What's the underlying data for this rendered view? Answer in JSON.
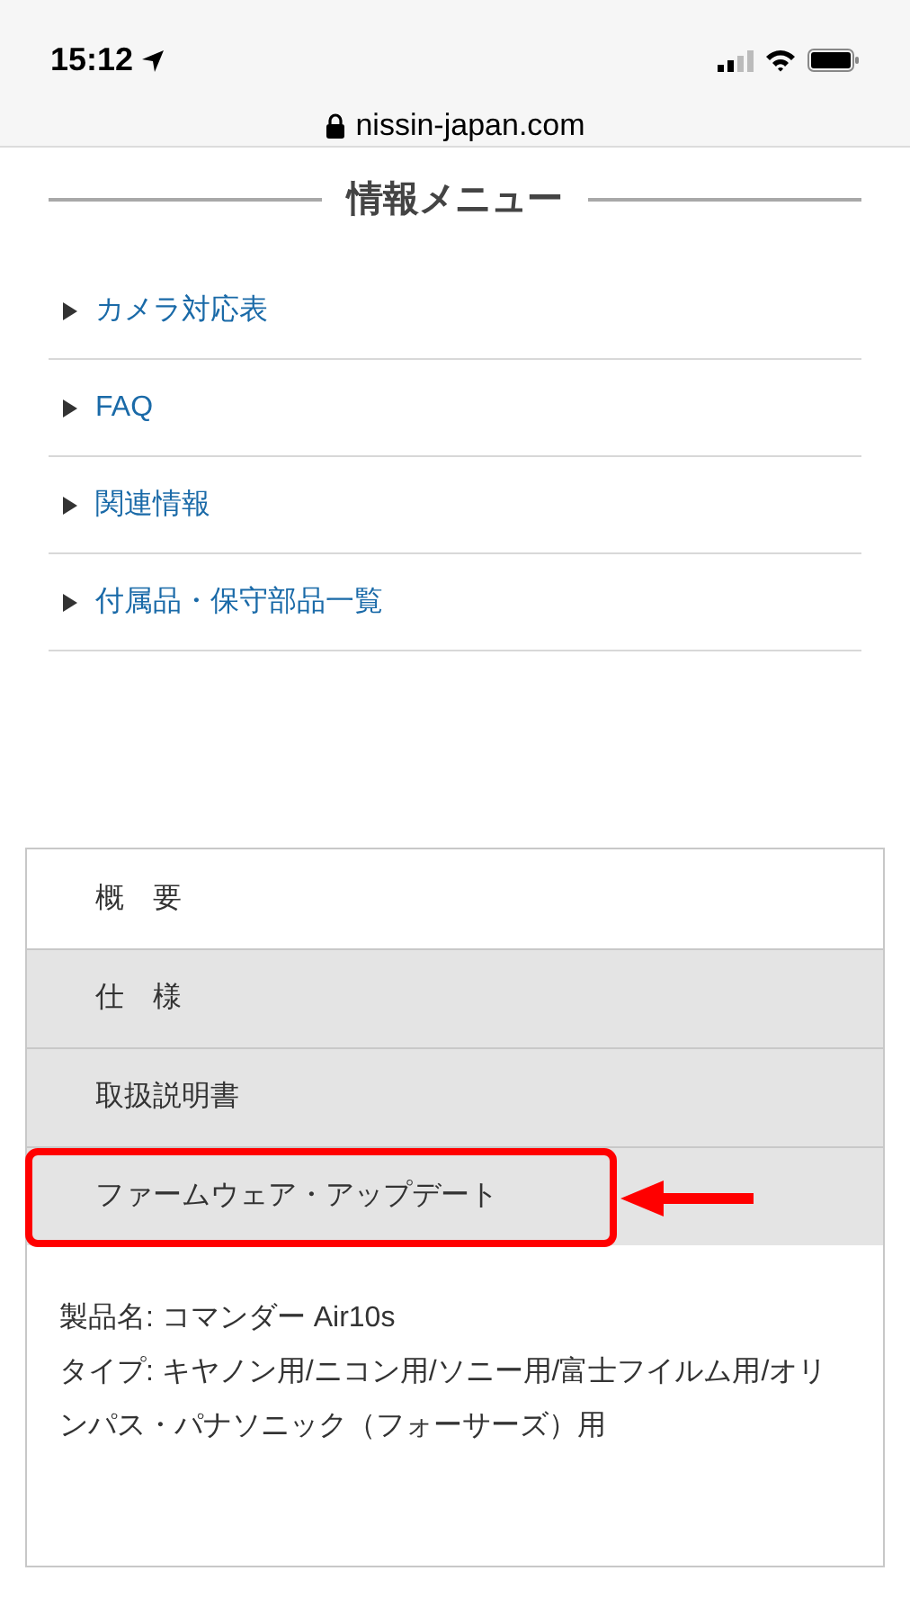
{
  "status_bar": {
    "time": "15:12",
    "url": "nissin-japan.com"
  },
  "section_title": "情報メニュー",
  "menu_items": [
    {
      "label": "カメラ対応表"
    },
    {
      "label": "FAQ"
    },
    {
      "label": "関連情報"
    },
    {
      "label": "付属品・保守部品一覧"
    }
  ],
  "tabs": [
    {
      "label": "概　要",
      "selected": true,
      "highlighted": false
    },
    {
      "label": "仕　様",
      "selected": false,
      "highlighted": false
    },
    {
      "label": "取扱説明書",
      "selected": false,
      "highlighted": false
    },
    {
      "label": "ファームウェア・アップデート",
      "selected": false,
      "highlighted": true
    }
  ],
  "product_info": [
    "製品名: コマンダー Air10s",
    "タイプ: キヤノン用/ニコン用/ソニー用/富士フイルム用/オリンパス・パナソニック（フォーサーズ）用"
  ]
}
